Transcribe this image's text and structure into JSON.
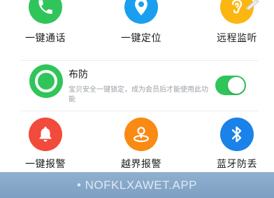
{
  "row1": [
    {
      "label": "一键通话",
      "icon": "phone-icon",
      "color": "#2fc55a"
    },
    {
      "label": "一键定位",
      "icon": "location-pin-icon",
      "color": "#1a9ff0"
    },
    {
      "label": "远程监听",
      "icon": "ear-icon",
      "color": "#fbb612"
    }
  ],
  "arm": {
    "title": "布防",
    "description": "宝贝安全一键锁定，成为会员后才能使用此功能",
    "toggle_on": true,
    "color": "#2fc55a"
  },
  "row3": [
    {
      "label": "一键报警",
      "icon": "bell-icon",
      "color": "#f24a3b"
    },
    {
      "label": "越界报警",
      "icon": "boundary-alarm-icon",
      "color": "#f98a14"
    },
    {
      "label": "蓝牙防丢",
      "icon": "bluetooth-icon",
      "color": "#1a82e8"
    }
  ],
  "watermark": "• NOFKLXAWET.APP"
}
